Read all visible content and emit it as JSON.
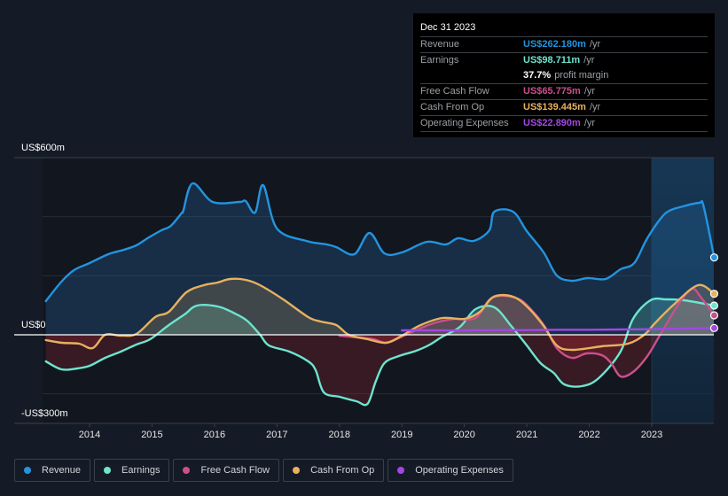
{
  "tooltip": {
    "date": "Dec 31 2023",
    "rows": [
      {
        "label": "Revenue",
        "value": "US$262.180m",
        "unit": "/yr",
        "color": "#2394df"
      },
      {
        "label": "Earnings",
        "value": "US$98.711m",
        "unit": "/yr",
        "color": "#6ce5cf"
      },
      {
        "label": "",
        "value": "37.7%",
        "unit": "profit margin",
        "color": "#ffffff"
      },
      {
        "label": "Free Cash Flow",
        "value": "US$65.775m",
        "unit": "/yr",
        "color": "#cc4f8c"
      },
      {
        "label": "Cash From Op",
        "value": "US$139.445m",
        "unit": "/yr",
        "color": "#e8b15f"
      },
      {
        "label": "Operating Expenses",
        "value": "US$22.890m",
        "unit": "/yr",
        "color": "#a347e3"
      }
    ]
  },
  "legend": [
    {
      "label": "Revenue",
      "color": "#2394df"
    },
    {
      "label": "Earnings",
      "color": "#6ce5cf"
    },
    {
      "label": "Free Cash Flow",
      "color": "#cc4f8c"
    },
    {
      "label": "Cash From Op",
      "color": "#e8b15f"
    },
    {
      "label": "Operating Expenses",
      "color": "#a347e3"
    }
  ],
  "chart_data": {
    "type": "area",
    "title": "",
    "xlabel": "",
    "ylabel": "",
    "y_tick_labels": [
      "US$600m",
      "US$0",
      "-US$300m"
    ],
    "ylim": [
      -300,
      600
    ],
    "xlim": [
      2013.3,
      2024.0
    ],
    "x_ticks": [
      2014,
      2015,
      2016,
      2017,
      2018,
      2019,
      2020,
      2021,
      2022,
      2023
    ],
    "highlight_range": [
      2023.0,
      2024.0
    ],
    "grid": true,
    "legend_position": "bottom",
    "series": [
      {
        "name": "Revenue",
        "color": "#2394df",
        "points": [
          [
            2013.3,
            114
          ],
          [
            2013.55,
            180
          ],
          [
            2013.75,
            219
          ],
          [
            2014.0,
            243
          ],
          [
            2014.3,
            273
          ],
          [
            2014.55,
            288
          ],
          [
            2014.75,
            303
          ],
          [
            2014.95,
            330
          ],
          [
            2015.15,
            354
          ],
          [
            2015.3,
            369
          ],
          [
            2015.48,
            414
          ],
          [
            2015.5,
            420
          ],
          [
            2015.65,
            513
          ],
          [
            2015.97,
            450
          ],
          [
            2016.4,
            450
          ],
          [
            2016.5,
            453
          ],
          [
            2016.65,
            414
          ],
          [
            2016.78,
            507
          ],
          [
            2017.0,
            360
          ],
          [
            2017.47,
            318
          ],
          [
            2017.8,
            306
          ],
          [
            2017.95,
            297
          ],
          [
            2018.24,
            273
          ],
          [
            2018.48,
            345
          ],
          [
            2018.72,
            276
          ],
          [
            2019.0,
            279
          ],
          [
            2019.4,
            315
          ],
          [
            2019.7,
            306
          ],
          [
            2019.9,
            327
          ],
          [
            2020.15,
            318
          ],
          [
            2020.4,
            354
          ],
          [
            2020.48,
            417
          ],
          [
            2020.78,
            417
          ],
          [
            2021.0,
            351
          ],
          [
            2021.27,
            279
          ],
          [
            2021.48,
            201
          ],
          [
            2021.72,
            183
          ],
          [
            2021.97,
            192
          ],
          [
            2022.26,
            189
          ],
          [
            2022.5,
            222
          ],
          [
            2022.72,
            243
          ],
          [
            2022.92,
            324
          ],
          [
            2023.14,
            393
          ],
          [
            2023.28,
            420
          ],
          [
            2023.5,
            435
          ],
          [
            2023.76,
            447
          ],
          [
            2023.83,
            435
          ],
          [
            2024.0,
            262
          ]
        ]
      },
      {
        "name": "Earnings",
        "color": "#6ce5cf",
        "points": [
          [
            2013.3,
            -90
          ],
          [
            2013.55,
            -117
          ],
          [
            2013.8,
            -114
          ],
          [
            2014.0,
            -105
          ],
          [
            2014.25,
            -78
          ],
          [
            2014.5,
            -57
          ],
          [
            2014.75,
            -33
          ],
          [
            2014.97,
            -15
          ],
          [
            2015.25,
            30
          ],
          [
            2015.52,
            69
          ],
          [
            2015.72,
            99
          ],
          [
            2016.05,
            96
          ],
          [
            2016.3,
            75
          ],
          [
            2016.52,
            48
          ],
          [
            2016.73,
            0
          ],
          [
            2016.87,
            -36
          ],
          [
            2017.2,
            -57
          ],
          [
            2017.5,
            -90
          ],
          [
            2017.62,
            -120
          ],
          [
            2017.75,
            -195
          ],
          [
            2018.0,
            -210
          ],
          [
            2018.27,
            -225
          ],
          [
            2018.45,
            -234
          ],
          [
            2018.58,
            -159
          ],
          [
            2018.72,
            -96
          ],
          [
            2018.95,
            -72
          ],
          [
            2019.23,
            -54
          ],
          [
            2019.45,
            -33
          ],
          [
            2019.65,
            -6
          ],
          [
            2019.93,
            27
          ],
          [
            2020.18,
            87
          ],
          [
            2020.48,
            93
          ],
          [
            2020.75,
            30
          ],
          [
            2021.0,
            -36
          ],
          [
            2021.22,
            -96
          ],
          [
            2021.43,
            -129
          ],
          [
            2021.6,
            -168
          ],
          [
            2021.88,
            -174
          ],
          [
            2022.15,
            -147
          ],
          [
            2022.5,
            -57
          ],
          [
            2022.7,
            54
          ],
          [
            2022.98,
            117
          ],
          [
            2023.24,
            120
          ],
          [
            2023.52,
            117
          ],
          [
            2024.0,
            99
          ]
        ]
      },
      {
        "name": "Free Cash Flow",
        "color": "#cc4f8c",
        "points": [
          [
            2018.0,
            -3
          ],
          [
            2018.3,
            -9
          ],
          [
            2018.55,
            -15
          ],
          [
            2018.75,
            -27
          ],
          [
            2019.0,
            -6
          ],
          [
            2019.25,
            18
          ],
          [
            2019.55,
            42
          ],
          [
            2019.85,
            54
          ],
          [
            2020.18,
            57
          ],
          [
            2020.45,
            126
          ],
          [
            2020.85,
            123
          ],
          [
            2021.1,
            78
          ],
          [
            2021.3,
            24
          ],
          [
            2021.48,
            -45
          ],
          [
            2021.72,
            -78
          ],
          [
            2021.96,
            -63
          ],
          [
            2022.2,
            -69
          ],
          [
            2022.35,
            -96
          ],
          [
            2022.5,
            -141
          ],
          [
            2022.7,
            -126
          ],
          [
            2022.93,
            -72
          ],
          [
            2023.15,
            6
          ],
          [
            2023.45,
            111
          ],
          [
            2023.65,
            156
          ],
          [
            2023.79,
            126
          ],
          [
            2024.0,
            66
          ]
        ]
      },
      {
        "name": "Cash From Op",
        "color": "#e8b15f",
        "points": [
          [
            2013.3,
            -18
          ],
          [
            2013.55,
            -27
          ],
          [
            2013.83,
            -30
          ],
          [
            2014.05,
            -45
          ],
          [
            2014.25,
            0
          ],
          [
            2014.5,
            -3
          ],
          [
            2014.75,
            3
          ],
          [
            2015.05,
            60
          ],
          [
            2015.27,
            78
          ],
          [
            2015.55,
            144
          ],
          [
            2015.83,
            168
          ],
          [
            2016.05,
            177
          ],
          [
            2016.25,
            189
          ],
          [
            2016.5,
            186
          ],
          [
            2016.73,
            168
          ],
          [
            2017.1,
            120
          ],
          [
            2017.5,
            60
          ],
          [
            2017.7,
            45
          ],
          [
            2017.95,
            33
          ],
          [
            2018.15,
            0
          ],
          [
            2018.45,
            -15
          ],
          [
            2018.75,
            -27
          ],
          [
            2019.0,
            -3
          ],
          [
            2019.3,
            33
          ],
          [
            2019.65,
            57
          ],
          [
            2020.0,
            54
          ],
          [
            2020.25,
            78
          ],
          [
            2020.47,
            129
          ],
          [
            2020.78,
            129
          ],
          [
            2021.03,
            90
          ],
          [
            2021.27,
            30
          ],
          [
            2021.48,
            -36
          ],
          [
            2021.72,
            -51
          ],
          [
            2022.2,
            -39
          ],
          [
            2022.62,
            -30
          ],
          [
            2022.88,
            0
          ],
          [
            2023.05,
            39
          ],
          [
            2023.35,
            102
          ],
          [
            2023.74,
            168
          ],
          [
            2024.0,
            139
          ]
        ]
      },
      {
        "name": "Operating Expenses",
        "color": "#a347e3",
        "points": [
          [
            2019.0,
            15
          ],
          [
            2019.5,
            15
          ],
          [
            2020.0,
            15
          ],
          [
            2020.5,
            16
          ],
          [
            2021.0,
            16
          ],
          [
            2021.5,
            17
          ],
          [
            2022.0,
            17
          ],
          [
            2022.5,
            18
          ],
          [
            2023.0,
            19
          ],
          [
            2023.5,
            21
          ],
          [
            2024.0,
            23
          ]
        ]
      }
    ]
  }
}
